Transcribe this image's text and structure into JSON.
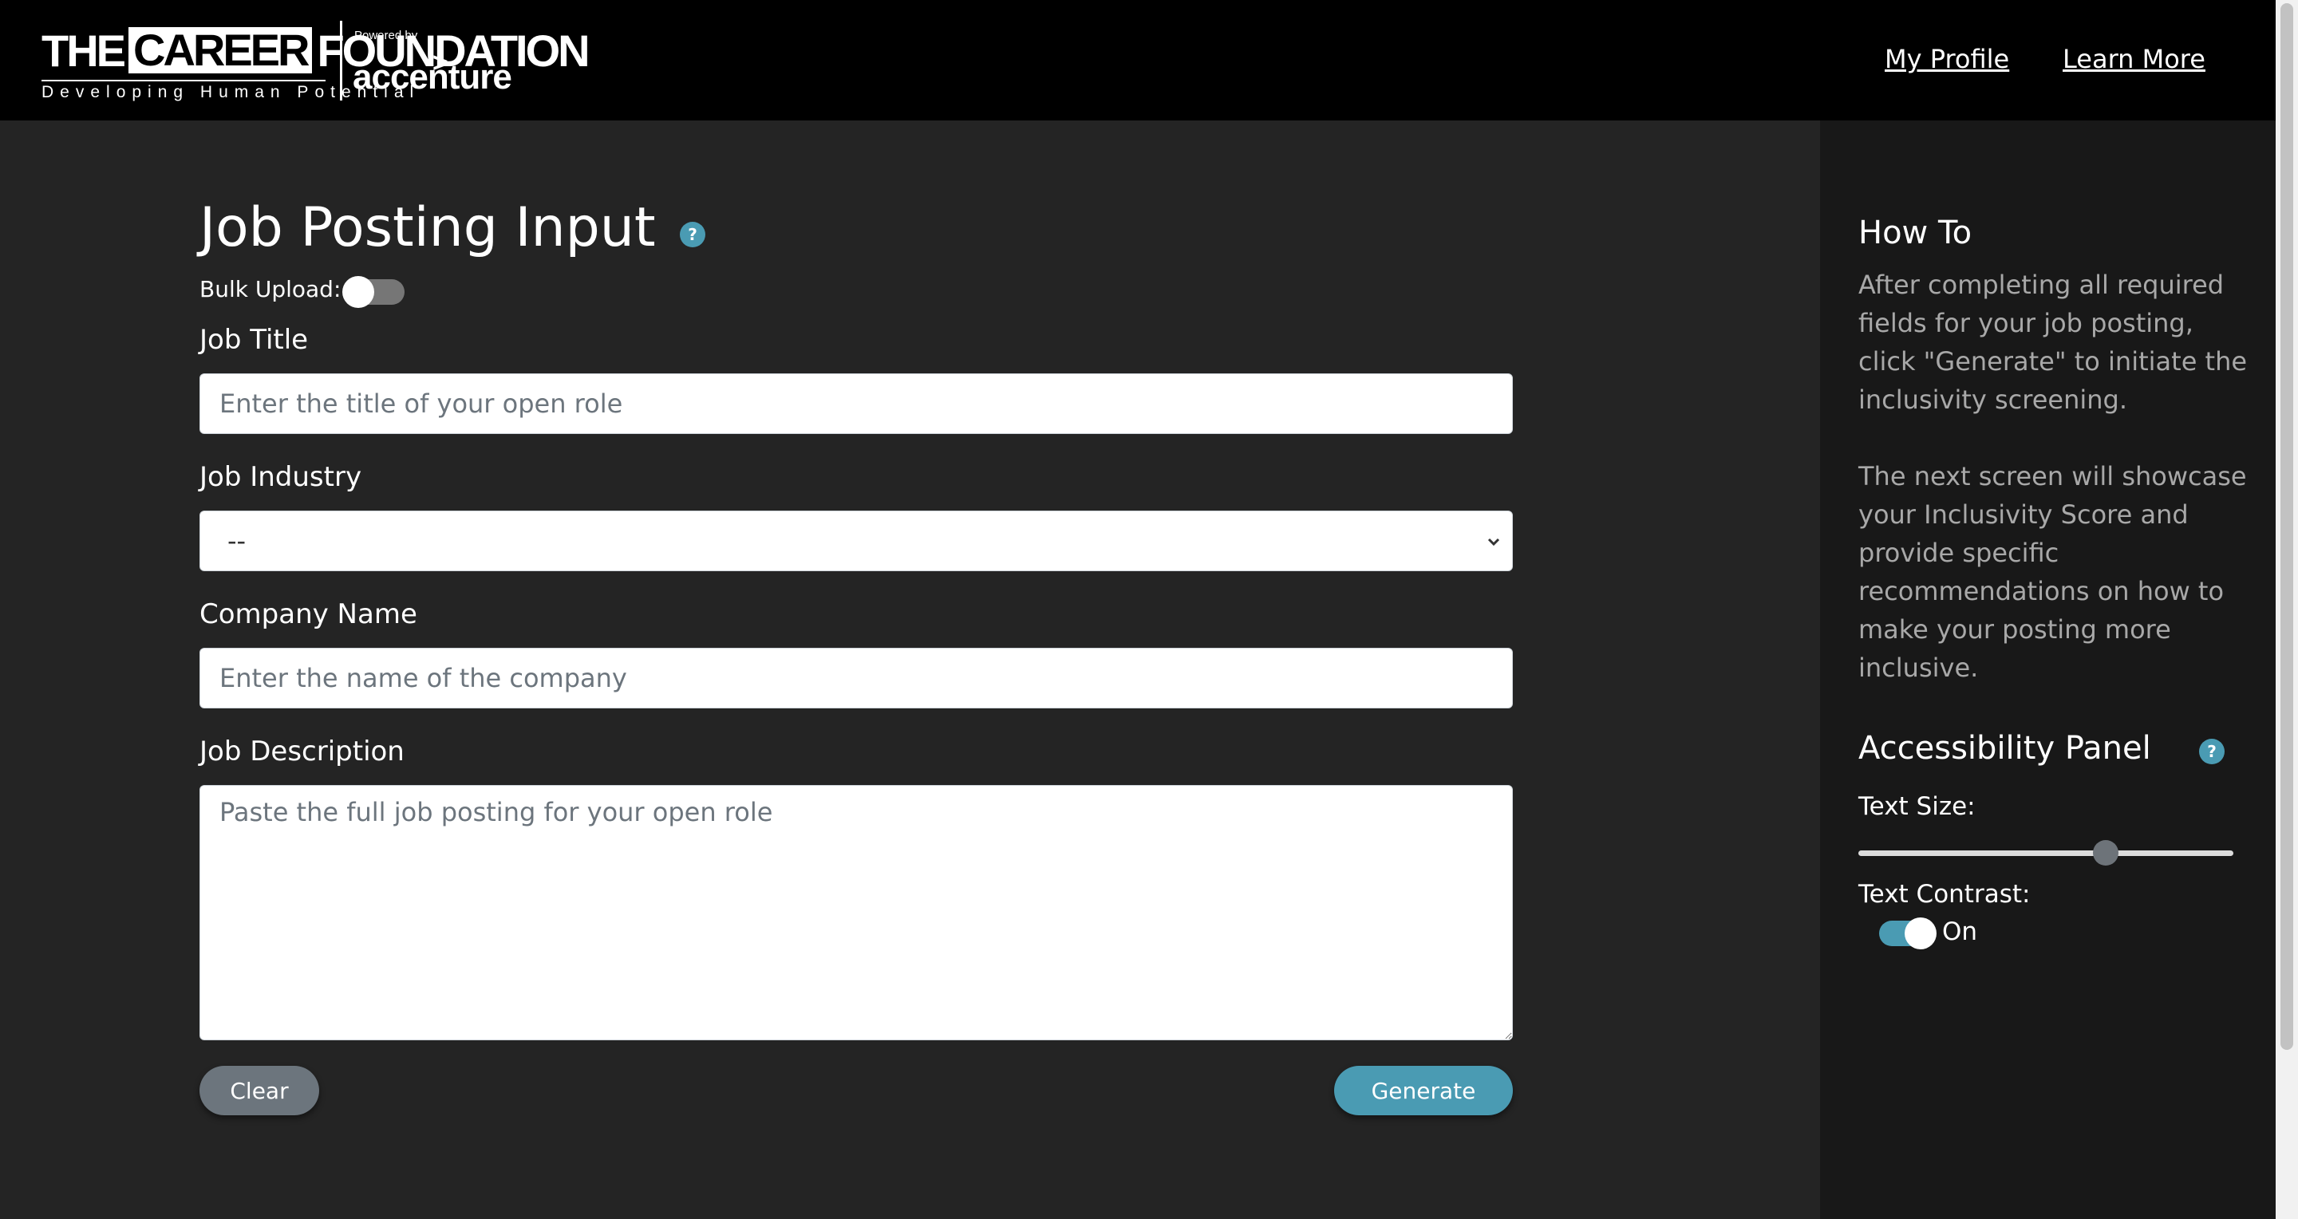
{
  "header": {
    "logo": {
      "brand_the": "THE",
      "brand_career": "CAREER",
      "brand_foundation": "FOUNDATION",
      "tagline": "Developing Human Potential",
      "powered_by": "Powered by",
      "partner": "accenture",
      "partner_mark": ">"
    },
    "nav": {
      "profile": "My Profile",
      "learn_more": "Learn More"
    }
  },
  "main": {
    "title": "Job Posting Input",
    "help_icon": "?",
    "bulk_upload": {
      "label": "Bulk Upload:",
      "enabled": false
    },
    "fields": {
      "job_title": {
        "label": "Job Title",
        "placeholder": "Enter the title of your open role",
        "value": ""
      },
      "job_industry": {
        "label": "Job Industry",
        "selected": "--"
      },
      "company_name": {
        "label": "Company Name",
        "placeholder": "Enter the name of the company",
        "value": ""
      },
      "job_description": {
        "label": "Job Description",
        "placeholder": "Paste the full job posting for your open role",
        "value": ""
      }
    },
    "buttons": {
      "clear": "Clear",
      "generate": "Generate"
    }
  },
  "sidebar": {
    "how_to": {
      "title": "How To",
      "paragraph1": "After completing all required fields for your job posting, click \"Generate\" to initiate the inclusivity screening.",
      "paragraph2": "The next screen will showcase your Inclusivity Score and provide specific recommendations on how to make your posting more inclusive."
    },
    "accessibility": {
      "title": "Accessibility Panel",
      "help_icon": "?",
      "text_size_label": "Text Size:",
      "text_size_level": 0.66,
      "text_contrast_label": "Text Contrast:",
      "text_contrast_state": "On"
    }
  },
  "colors": {
    "header_bg": "#000000",
    "page_bg": "#242424",
    "sidebar_bg": "#181818",
    "accent": "#4a9bb3",
    "clear_button": "#6c757d"
  }
}
